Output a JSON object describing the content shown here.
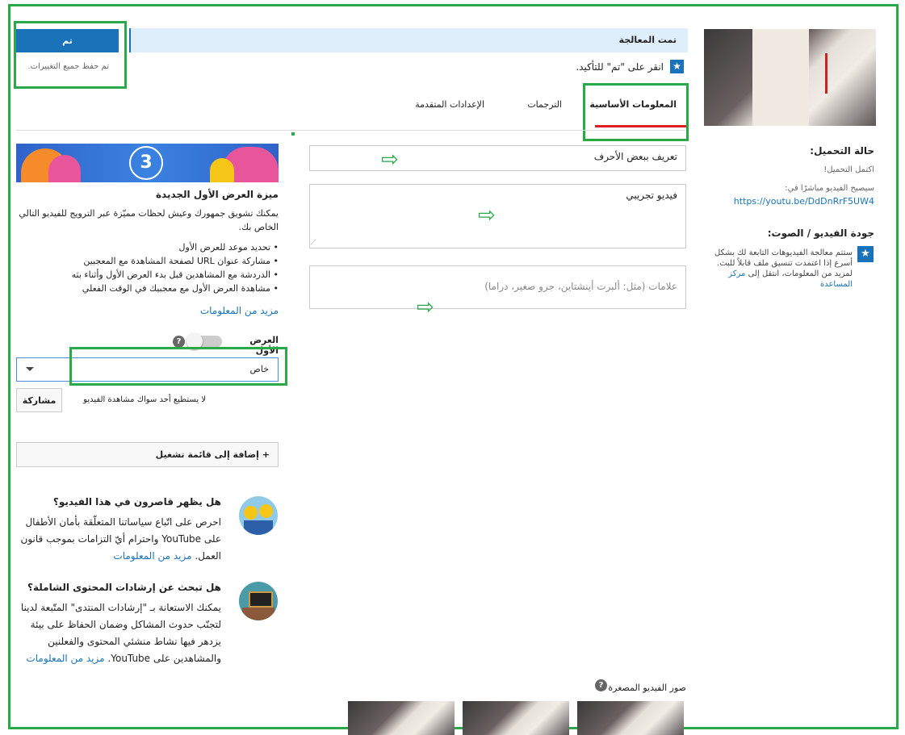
{
  "header": {
    "processing_title": "تمت المعالجة",
    "confirm_hint": "انقر على \"تم\" للتأكيد.",
    "done_button": "تم",
    "saved_note": "تم حفظ جميع التغييرات."
  },
  "tabs": [
    {
      "label": "المعلومات الأساسية",
      "active": true
    },
    {
      "label": "الترجمات",
      "active": false
    },
    {
      "label": "الإعدادات المتقدمة",
      "active": false
    }
  ],
  "form": {
    "title_value": "تعريف ببعض الأحرف",
    "description_value": "فيديو تجريبي",
    "tags_placeholder": "علامات (مثل: ألبرت أينشتاين، جرو صغير، دراما)"
  },
  "upload_status": {
    "heading": "حالة التحميل:",
    "status": "اكتمل التحميل!",
    "available_at": "سيصبح الفيديو مباشرًا في:",
    "url": "https://youtu.be/DdDnRrF5UW4"
  },
  "quality": {
    "heading": "جودة الفيديو / الصوت:",
    "text": "ستتم معالجة الفيديوهات التابعة لك بشكل أسرع إذا اعتمدت تنسيق ملف قابلاً للبث. لمزيد من المعلومات، انتقل إلى",
    "link": "مركز المساعدة"
  },
  "premiere": {
    "banner_number": "3",
    "title": "ميزة العرض الأول الجديدة",
    "description": "يمكنك تشويق جمهورك وعيش لحظات مميّزة عبر الترويج للفيديو التالي الخاص بك.",
    "bullets": [
      "• تحديد موعد للعرض الأول",
      "• مشاركة عنوان URL لصفحة المشاهدة مع المعجبين",
      "• الدردشة مع المشاهدين قبل بدء العرض الأول وأثناء بثه",
      "• مشاهدة العرض الأول مع معجبيك في الوقت الفعلي"
    ],
    "more_link": "مزيد من المعلومات",
    "toggle_label": "العرض الأول",
    "help": "?"
  },
  "privacy": {
    "selected": "خاص",
    "share_button": "مشاركة",
    "note": "لا يستطيع أحد سواك مشاهدة الفيديو"
  },
  "playlist": {
    "add_button": "+ إضافة إلى قائمة تشغيل"
  },
  "kids": {
    "title": "هل يظهر قاصرون في هذا الفيديو؟",
    "text": "احرص على اتّباع سياساتنا المتعلّقة بأمان الأطفال على YouTube واحترام أيّ التزامات بموجب قانون العمل.",
    "link": "مزيد من المعلومات"
  },
  "community": {
    "title": "هل تبحث عن إرشادات المحتوى الشاملة؟",
    "text": "يمكنك الاستعانة بـ \"إرشادات المنتدى\" المتّبعة لدينا لتجنّب حدوث المشاكل وضمان الحفاظ على بيئة يزدهر فيها نشاط منشئي المحتوى والفعلنين والمشاهدين على YouTube.",
    "link": "مزيد من المعلومات"
  },
  "thumbnails": {
    "label": "صور الفيديو المصغرة",
    "help": "?"
  },
  "colors": {
    "accent_blue": "#1a73b8",
    "annotation_green": "#2aa84a",
    "tab_underline": "#e02020",
    "processing_bar": "#dfeefb"
  }
}
